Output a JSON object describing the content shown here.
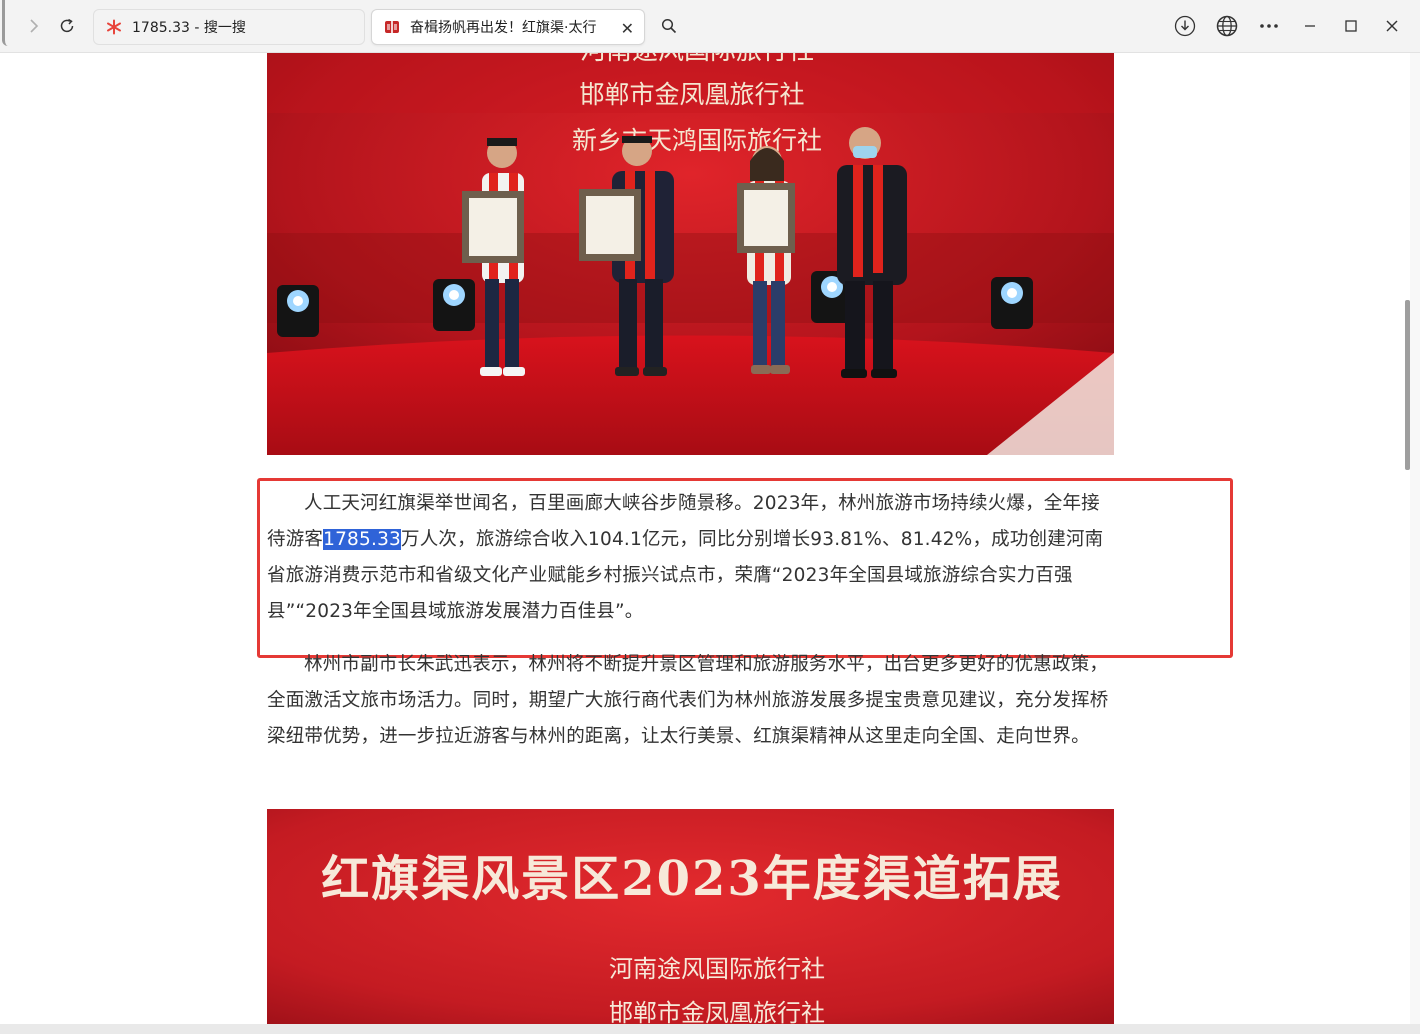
{
  "browser": {
    "tabs": [
      {
        "title": "1785.33 - 搜一搜",
        "active": false,
        "favicon": "sousou-star-icon"
      },
      {
        "title": "奋楫扬帆再出发！红旗渠·太行",
        "active": true,
        "favicon": "news-book-icon"
      }
    ],
    "accent_color": "#2f63d8"
  },
  "article": {
    "photo1_signs": [
      "河南途风国际旅行社",
      "邯郸市金凤凰旅行社",
      "新乡市天鸿国际旅行社"
    ],
    "highlighted_paragraph": {
      "before": "人工天河红旗渠举世闻名，百里画廊大峡谷步随景移。2023年，林州旅游市场持续火爆，全年接待游客",
      "highlight": "1785.33",
      "after": "万人次，旅游综合收入104.1亿元，同比分别增长93.81%、81.42%，成功创建河南省旅游消费示范市和省级文化产业赋能乡村振兴试点市，荣膺“2023年全国县域旅游综合实力百强县”“2023年全国县域旅游发展潜力百佳县”。"
    },
    "paragraph2": "林州市副市长朱武迅表示，林州将不断提升景区管理和旅游服务水平，出台更多更好的优惠政策，全面激活文旅市场活力。同时，期望广大旅行商代表们为林州旅游发展多提宝贵意见建议，充分发挥桥梁纽带优势，进一步拉近游客与林州的距离，让太行美景、红旗渠精神从这里走向全国、走向世界。",
    "photo2_banner": "红旗渠风景区2023年度渠道拓展",
    "photo2_signs": [
      "河南途风国际旅行社",
      "邯郸市金凤凰旅行社"
    ],
    "annotation_color": "#e53935"
  }
}
